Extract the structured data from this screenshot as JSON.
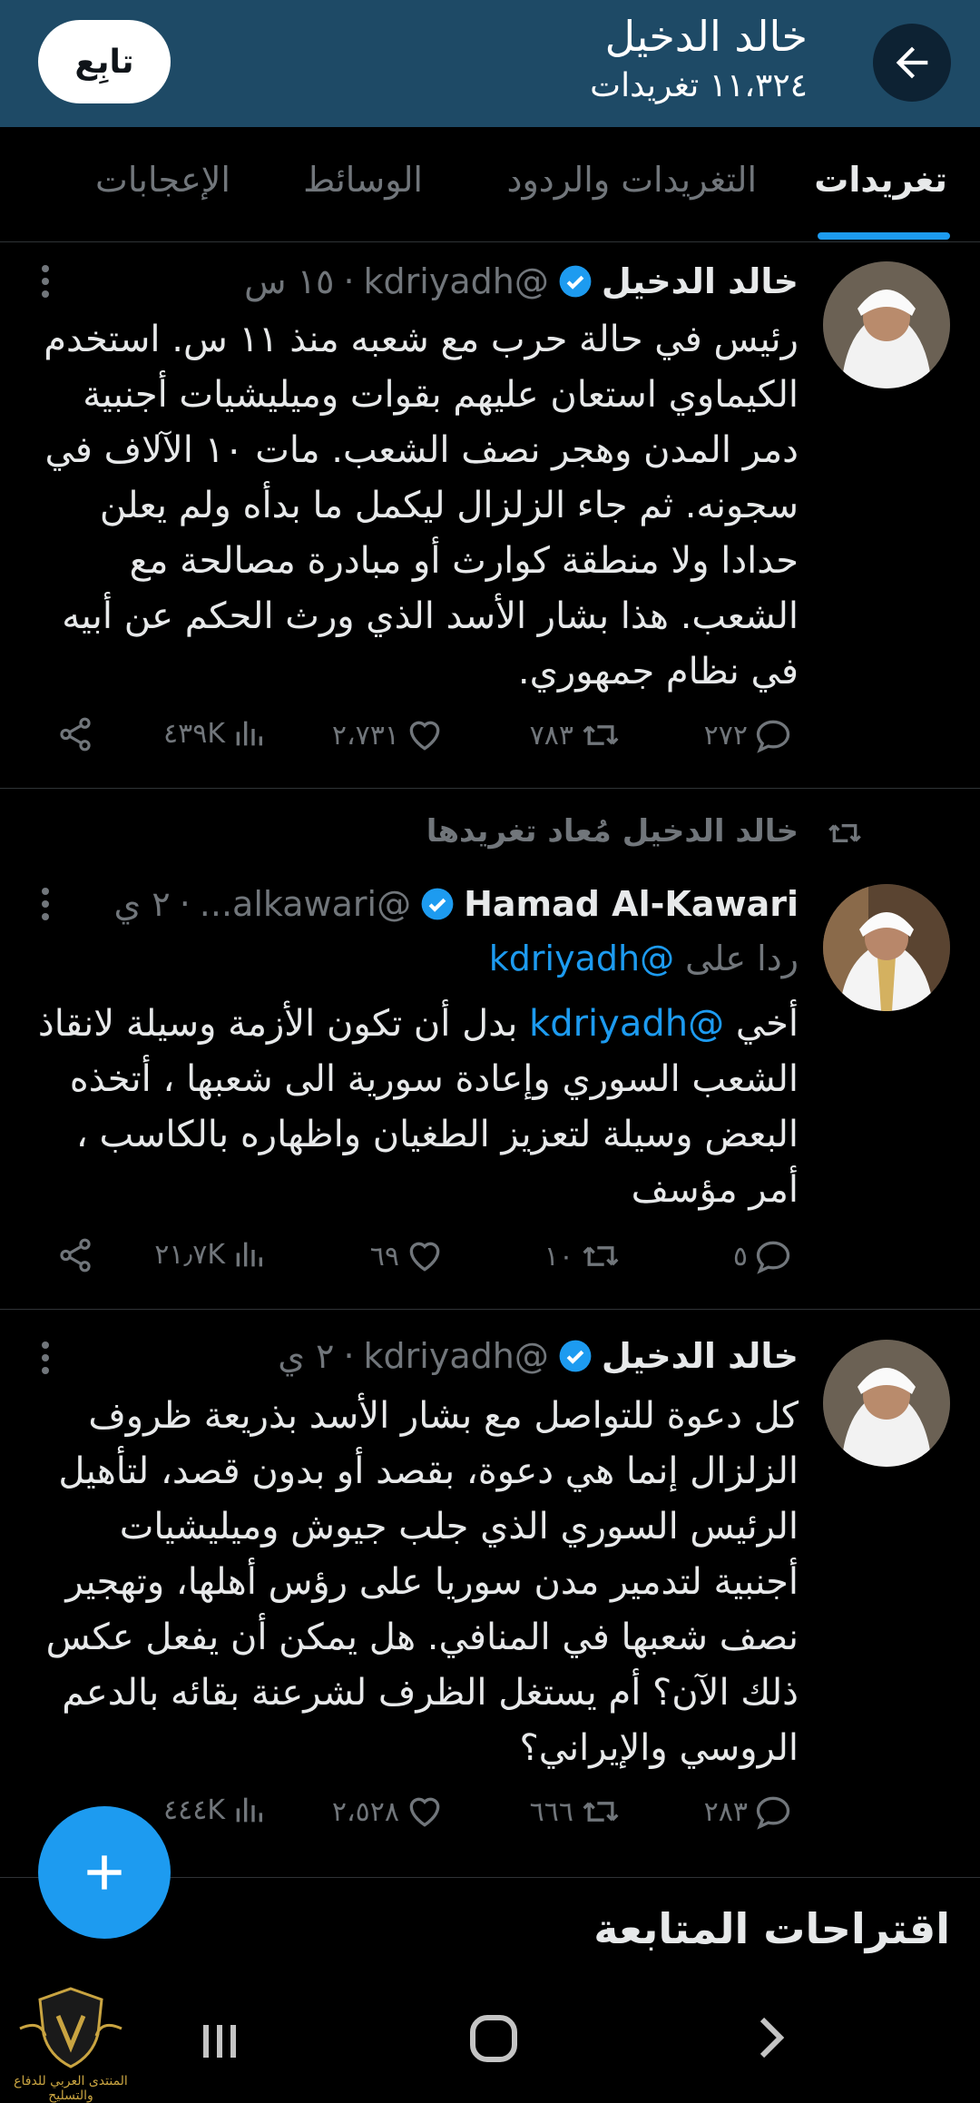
{
  "header": {
    "name": "خالد الدخيل",
    "tweet_count": "١١،٣٢٤ تغريدات",
    "follow_label": "تابِع",
    "back_icon": "arrow-left-icon"
  },
  "tabs": [
    {
      "label": "تغريدات",
      "active": true
    },
    {
      "label": "التغريدات والردود",
      "active": false
    },
    {
      "label": "الوسائط",
      "active": false
    },
    {
      "label": "الإعجابات",
      "active": false
    }
  ],
  "tweets": [
    {
      "author": "خالد الدخيل",
      "handle": "@kdriyadh",
      "dot": "·",
      "time": "١٥ س",
      "verified": true,
      "text": "رئيس في حالة حرب مع شعبه منذ ١١ س. استخدم الكيماوي استعان عليهم بقوات وميليشيات أجنبية دمر المدن وهجر نصف الشعب. مات ١٠ الآلاف في سجونه. ثم جاء الزلزال ليكمل ما بدأه ولم يعلن حدادا ولا منطقة كوارث أو مبادرة مصالحة مع الشعب. هذا بشار الأسد الذي ورث الحكم عن أبيه في نظام جمهوري.",
      "replies": "٢٧٢",
      "retweets": "٧٨٣",
      "likes": "٢،٧٣١",
      "views": "٤٣٩K"
    },
    {
      "retweeted_by": "خالد الدخيل مُعاد تغريدها",
      "author": "Hamad Al-Kawari",
      "handle": "@alkawari...",
      "dot": "·",
      "time": "٢ ي",
      "verified": true,
      "reply_to_prefix": "ردا على",
      "reply_to_handle": "@kdriyadh",
      "text_prefix": "أخي",
      "text_mention": "@kdriyadh",
      "text_rest": "بدل أن تكون الأزمة وسيلة لانقاذ الشعب السوري وإعادة سورية الى شعبها ، أتخذه البعض وسيلة لتعزيز الطغيان واظهاره بالكاسب ، أمر مؤسف",
      "replies": "٥",
      "retweets": "١٠",
      "likes": "٦٩",
      "views": "٢١٫٧K"
    },
    {
      "author": "خالد الدخيل",
      "handle": "@kdriyadh",
      "dot": "·",
      "time": "٢ ي",
      "verified": true,
      "text": "كل دعوة للتواصل مع بشار الأسد بذريعة ظروف الزلزال إنما هي دعوة، بقصد أو بدون قصد، لتأهيل الرئيس السوري الذي جلب جيوش وميليشيات أجنبية لتدمير  مدن سوريا على رؤس أهلها، وتهجير نصف شعبها في المنافي. هل يمكن أن يفعل عكس ذلك الآن؟ أم يستغل الظرف لشرعنة بقائه بالدعم الروسي والإيراني؟",
      "replies": "٢٨٣",
      "retweets": "٦٦٦",
      "likes": "٢،٥٢٨",
      "views": "٤٤٤K"
    }
  ],
  "suggestions_title": "اقتراحات المتابعة",
  "watermark_text": "المنتدى العربي للدفاع والتسليح",
  "colors": {
    "header_bg": "#1e4a66",
    "accent": "#1d9bf0",
    "muted": "#71767b",
    "text": "#e7e9ea"
  }
}
